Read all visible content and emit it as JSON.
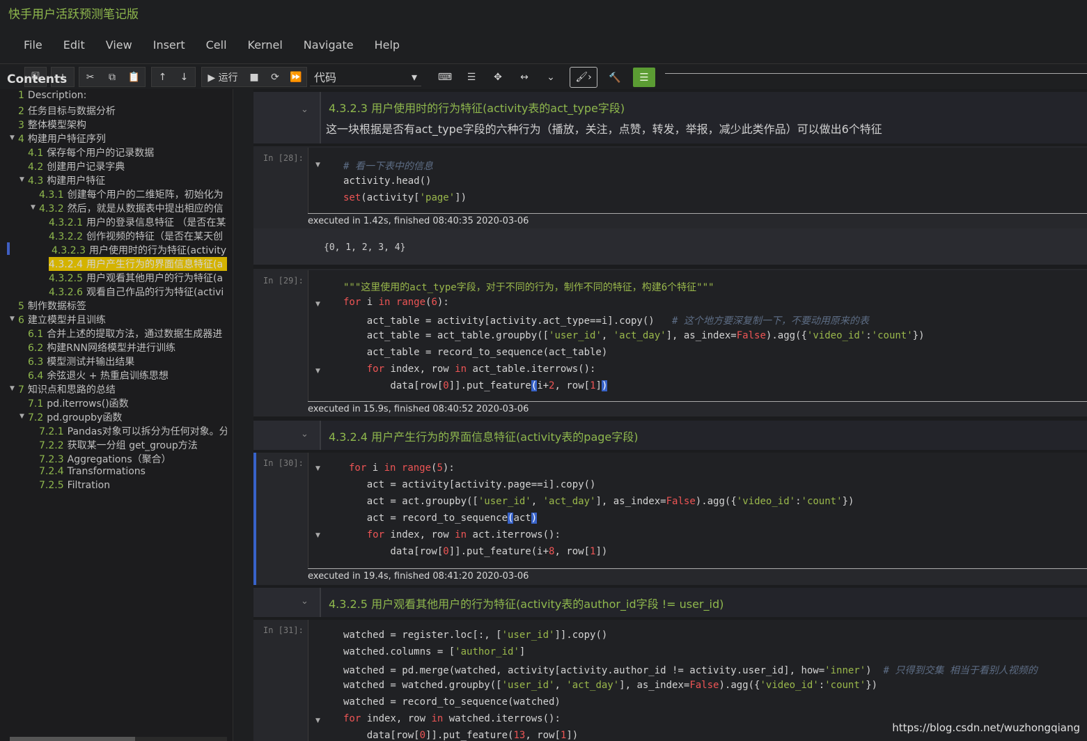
{
  "window": {
    "title": "快手用户活跃预测笔记版"
  },
  "menu": [
    "File",
    "Edit",
    "View",
    "Insert",
    "Cell",
    "Kernel",
    "Navigate",
    "Help"
  ],
  "toolbar": {
    "save": "🖫",
    "add": "+",
    "cut": "✂",
    "copy": "⧉",
    "paste": "📋",
    "up": "↑",
    "down": "↓",
    "run": "▶ 运行",
    "stop": "■",
    "restart": "⟳",
    "ff": "⏩",
    "cell_type": "代码",
    "cell_type_caret": "▾",
    "keyboard": "⌨",
    "list": "☰",
    "move": "✥",
    "arrows": "↔",
    "expand": "⌄",
    "brush": "🖌›",
    "wrench": "🔨",
    "grid": "☰"
  },
  "toc": {
    "header": "Contents",
    "items": [
      {
        "num": "1",
        "label": "Description:"
      },
      {
        "num": "2",
        "label": "任务目标与数据分析"
      },
      {
        "num": "3",
        "label": "整体模型架构"
      },
      {
        "num": "4",
        "label": "构建用户特征序列"
      },
      {
        "num": "4.1",
        "label": "保存每个用户的记录数据"
      },
      {
        "num": "4.2",
        "label": "创建用户记录字典"
      },
      {
        "num": "4.3",
        "label": "构建用户特征"
      },
      {
        "num": "4.3.1",
        "label": "创建每个用户的二维矩阵，初始化为"
      },
      {
        "num": "4.3.2",
        "label": "然后，就是从数据表中提出相应的信"
      },
      {
        "num": "4.3.2.1",
        "label": "用户的登录信息特征 （是否在某"
      },
      {
        "num": "4.3.2.2",
        "label": "创作视频的特征（是否在某天创"
      },
      {
        "num": "4.3.2.3",
        "label": "用户使用时的行为特征(activity"
      },
      {
        "num": "4.3.2.4",
        "label": "用户产生行为的界面信息特征(a"
      },
      {
        "num": "4.3.2.5",
        "label": "用户观看其他用户的行为特征(a"
      },
      {
        "num": "4.3.2.6",
        "label": "观看自己作品的行为特征(activi"
      },
      {
        "num": "5",
        "label": "制作数据标签"
      },
      {
        "num": "6",
        "label": "建立模型并且训练"
      },
      {
        "num": "6.1",
        "label": "合并上述的提取方法，通过数据生成器进"
      },
      {
        "num": "6.2",
        "label": "构建RNN网络模型并进行训练"
      },
      {
        "num": "6.3",
        "label": "模型测试并输出结果"
      },
      {
        "num": "6.4",
        "label": "余弦退火 + 热重启训练思想"
      },
      {
        "num": "7",
        "label": "知识点和思路的总结"
      },
      {
        "num": "7.1",
        "label": "pd.iterrows()函数"
      },
      {
        "num": "7.2",
        "label": "pd.groupby函数"
      },
      {
        "num": "7.2.1",
        "label": "Pandas对象可以拆分为任何对象。分"
      },
      {
        "num": "7.2.2",
        "label": "获取某一分组 get_group方法"
      },
      {
        "num": "7.2.3",
        "label": "Aggregations（聚合）"
      },
      {
        "num": "7.2.4",
        "label": "Transformations"
      },
      {
        "num": "7.2.5",
        "label": "Filtration"
      }
    ]
  },
  "cells": {
    "md1": {
      "h": "4.3.2.3 用户使用时的行为特征(activity表的act_type字段)",
      "p": "这一块根据是否有act_type字段的六种行为（播放，关注，点赞，转发，举报，减少此类作品）可以做出6个特征"
    },
    "c28": {
      "prompt": "In [28]:",
      "exec": "executed in 1.42s, finished 08:40:35 2020-03-06",
      "output": "{0, 1, 2, 3, 4}"
    },
    "c29": {
      "prompt": "In [29]:",
      "exec": "executed in 15.9s, finished 08:40:52 2020-03-06"
    },
    "md2": {
      "h": "4.3.2.4 用户产生行为的界面信息特征(activity表的page字段)"
    },
    "c30": {
      "prompt": "In [30]:",
      "exec": "executed in 19.4s, finished 08:41:20 2020-03-06"
    },
    "md3": {
      "h": "4.3.2.5 用户观看其他用户的行为特征(activity表的author_id字段 != user_id)"
    },
    "c31": {
      "prompt": "In [31]:"
    }
  },
  "watermark": "https://blog.csdn.net/wuzhongqiang"
}
